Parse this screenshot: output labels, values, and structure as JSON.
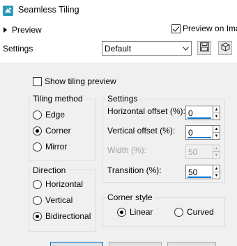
{
  "window": {
    "title": "Seamless Tiling"
  },
  "preview": {
    "toggle_label": "Preview",
    "preview_on_label": "Preview on Ima",
    "preview_on_checked": true
  },
  "settings_row": {
    "label": "Settings",
    "preset_value": "Default"
  },
  "show_tiling": {
    "label": "Show tiling preview",
    "checked": false
  },
  "tiling_method": {
    "title": "Tiling method",
    "options": [
      {
        "label": "Edge",
        "selected": false
      },
      {
        "label": "Corner",
        "selected": true
      },
      {
        "label": "Mirror",
        "selected": false
      }
    ]
  },
  "direction": {
    "title": "Direction",
    "options": [
      {
        "label": "Horizontal",
        "selected": false
      },
      {
        "label": "Vertical",
        "selected": false
      },
      {
        "label": "Bidirectional",
        "selected": true
      }
    ]
  },
  "settings_group": {
    "title": "Settings",
    "horizontal_offset": {
      "label": "Horizontal offset (%):",
      "value": "0"
    },
    "vertical_offset": {
      "label": "Vertical offset (%):",
      "value": "0"
    },
    "width": {
      "label": "Width (%):",
      "value": "50",
      "disabled": true
    },
    "transition": {
      "label": "Transition (%):",
      "value": "50"
    }
  },
  "corner_style": {
    "title": "Corner style",
    "options": [
      {
        "label": "Linear",
        "selected": true
      },
      {
        "label": "Curved",
        "selected": false
      }
    ]
  },
  "colors": {
    "accent": "#0078d7",
    "panel": "#f0f0f0",
    "icon": "#2a9bb7"
  },
  "icons": [
    "app-icon",
    "chevron-down-icon",
    "save-icon",
    "cube-icon",
    "spin-up-icon",
    "spin-down-icon"
  ]
}
